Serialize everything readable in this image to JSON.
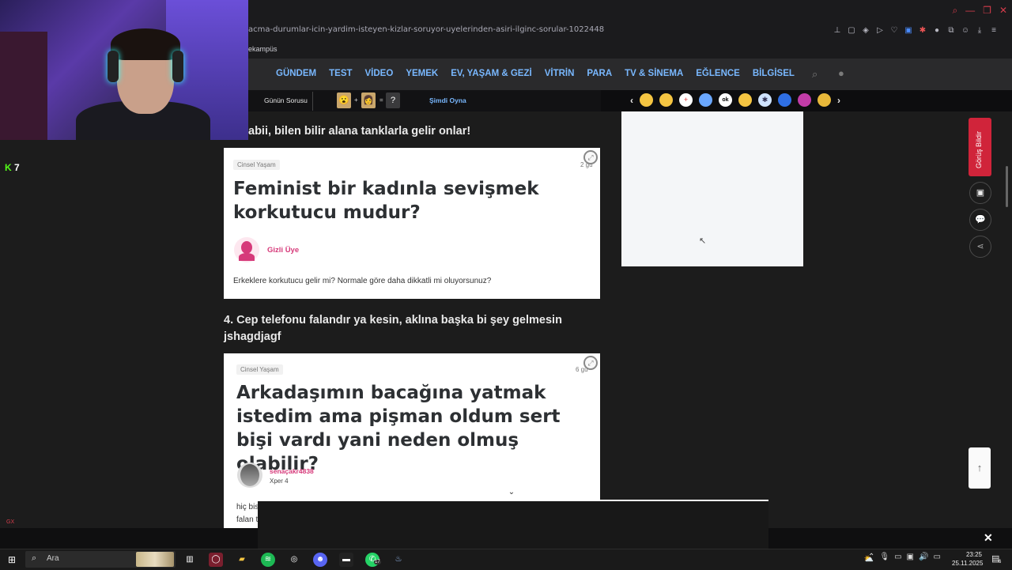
{
  "browser": {
    "url": "acma-durumlar-icin-yardim-isteyen-kizlar-soruyor-uyelerinden-asiri-ilginc-sorular-1022448",
    "bookmark": "ekampüs"
  },
  "nav": {
    "items": [
      "GÜNDEM",
      "TEST",
      "VİDEO",
      "YEMEK",
      "EV, YAŞAM & GEZİ",
      "VİTRİN",
      "PARA",
      "TV & SİNEMA",
      "EĞLENCE",
      "BİLGİSEL"
    ]
  },
  "subbar": {
    "gunun_sorusu": "Günün Sorusu",
    "plus": "+",
    "equals": "=",
    "question": "?",
    "play": "Şimdi Oyna",
    "emojis": [
      "😢",
      "😊",
      "🤕",
      "😐",
      "ok",
      "🤬",
      "❄",
      "😐",
      "🎁",
      "💰"
    ]
  },
  "content": {
    "heading_top": "abii, bilen bilir alana tanklarla gelir onlar!",
    "card1": {
      "category": "Cinsel Yaşam",
      "days": "2 gü",
      "title": "Feminist bir kadınla sevişmek korkutucu mudur?",
      "user": "Gizli Üye",
      "desc": "Erkeklere korkutucu gelir mi? Normale göre daha dikkatli mi oluyorsunuz?"
    },
    "heading_4": "4. Cep telefonu falandır ya kesin, aklına başka bi şey gelmesin jshagdjagf",
    "card2": {
      "category": "Cinsel Yaşam",
      "days": "6 gü",
      "title": "Arkadaşımın bacağına yatmak istedim ama pişman oldum sert bişi vardı yani neden olmuş olabilir?",
      "user": "senaçakr4838",
      "xper": "Xper 4",
      "desc_line1": "hiç bis",
      "desc_line2": "falan t"
    }
  },
  "side": {
    "gorus": "Görüş Bildir"
  },
  "overlay": {
    "kick_count": "7",
    "gx": "GX"
  },
  "taskbar": {
    "search": "Ara",
    "whatsapp_badge": "17",
    "time": "23:25",
    "date": "25.11.2025",
    "notif_count": "6"
  }
}
